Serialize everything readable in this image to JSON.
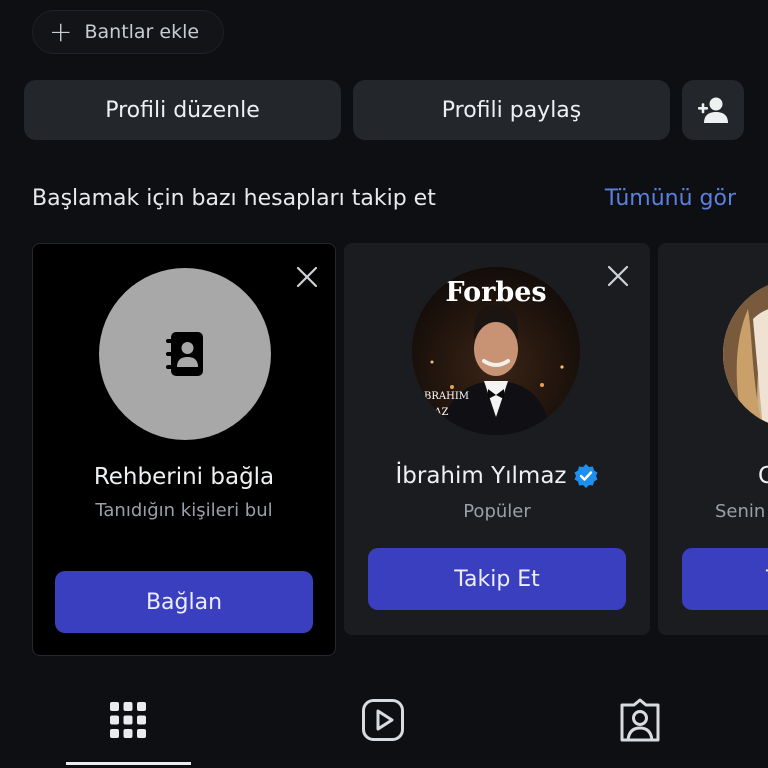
{
  "chip": {
    "label": "Bantlar ekle",
    "icon": "plus-icon"
  },
  "actions": {
    "edit_profile": "Profili düzenle",
    "share_profile": "Profili paylaş",
    "add_friend_icon": "add-person-icon"
  },
  "suggestions": {
    "title": "Başlamak için bazı hesapları takip et",
    "see_all": "Tümünü gör",
    "cards": [
      {
        "type": "contacts",
        "name": "Rehberini bağla",
        "subtitle": "Tanıdığın kişileri bul",
        "button": "Bağlan"
      },
      {
        "type": "person",
        "name": "İbrahim Yılmaz",
        "verified": true,
        "subtitle": "Popüler",
        "button": "Takip Et",
        "photo_text": "Forbes",
        "photo_caption_1": "BRAHIM",
        "photo_caption_2": "MAZ"
      },
      {
        "type": "person-partial",
        "name_partial": "G",
        "subtitle_partial": "Senin",
        "button_partial": "T"
      }
    ]
  },
  "tabs": [
    "grid-icon",
    "reels-icon",
    "tagged-icon"
  ],
  "colors": {
    "accent": "#3a3fbf",
    "link": "#5b7fe0",
    "background": "#0d0f12",
    "verified": "#1d8ff0"
  }
}
